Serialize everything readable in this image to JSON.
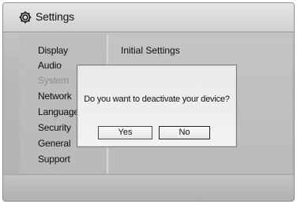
{
  "window": {
    "title": "Settings",
    "title_icon": "gear-icon"
  },
  "sidebar": {
    "items": [
      {
        "label": "Display",
        "state": "normal"
      },
      {
        "label": "Audio",
        "state": "normal"
      },
      {
        "label": "System",
        "state": "selected"
      },
      {
        "label": "Network",
        "state": "normal"
      },
      {
        "label": "Language",
        "state": "normal"
      },
      {
        "label": "Security",
        "state": "normal"
      },
      {
        "label": "General",
        "state": "normal"
      },
      {
        "label": "Support",
        "state": "normal"
      }
    ]
  },
  "content": {
    "title": "Initial Settings"
  },
  "dialog": {
    "message": "Do you want to deactivate your device?",
    "yes_label": "Yes",
    "no_label": "No",
    "focused": "No"
  }
}
